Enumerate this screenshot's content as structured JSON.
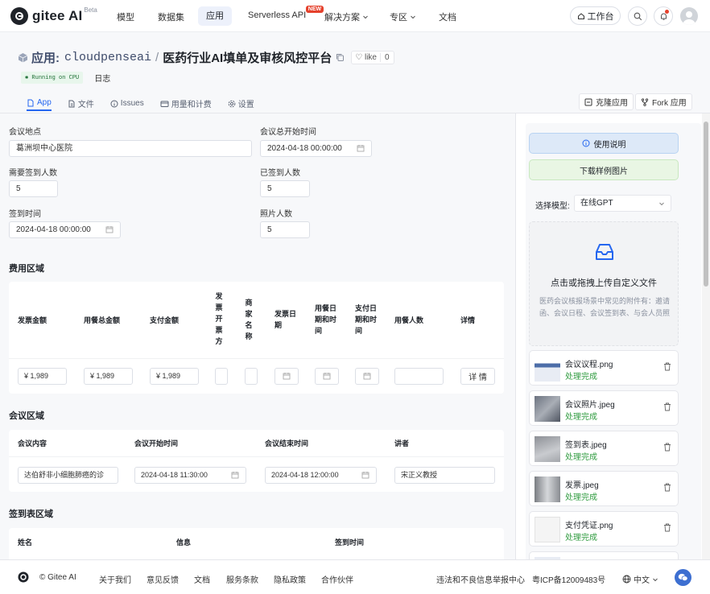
{
  "nav": {
    "logo_text": "gitee AI",
    "beta": "Beta",
    "items": [
      "模型",
      "数据集",
      "应用",
      "Serverless API",
      "解决方案",
      "专区",
      "文档"
    ],
    "new_badge": "NEW",
    "workbench": "工作台"
  },
  "header": {
    "app_label": "应用:",
    "owner": "cloudpenseai",
    "separator": "/",
    "app_name": "医药行业AI填单及审核风控平台",
    "like_label": "like",
    "like_count": "0",
    "status": "Running on CPU",
    "log": "日志",
    "tabs": [
      "App",
      "文件",
      "Issues",
      "用量和计费",
      "设置"
    ],
    "clone": "克隆应用",
    "fork": "Fork 应用"
  },
  "form": {
    "location_label": "会议地点",
    "location_value": "葛洲坝中心医院",
    "start_label": "会议总开始时间",
    "start_value": "2024-04-18 00:00:00",
    "signin_need_label": "需要签到人数",
    "signin_need_value": "5",
    "signed_label": "已签到人数",
    "signed_value": "5",
    "signin_time_label": "签到时间",
    "signin_time_value": "2024-04-18 00:00:00",
    "photo_label": "照片人数",
    "photo_value": "5"
  },
  "expense": {
    "title": "费用区域",
    "headers": [
      "发票金额",
      "用餐总金额",
      "支付金额",
      "发票开票方",
      "商家名称",
      "发票日期",
      "用餐日期和时间",
      "支付日期和时间",
      "用餐人数",
      "详情"
    ],
    "row": {
      "invoice": "¥ 1,989",
      "meal_total": "¥ 1,989",
      "payment": "¥ 1,989",
      "detail": "详 情"
    }
  },
  "meeting": {
    "title": "会议区域",
    "headers": [
      "会议内容",
      "会议开始时间",
      "会议结束时间",
      "讲者"
    ],
    "row": {
      "content": "达伯舒非小细胞肺癌的诊",
      "start": "2024-04-18 11:30:00",
      "end": "2024-04-18 12:00:00",
      "speaker": "宋正义教授"
    }
  },
  "signin_table": {
    "title": "签到表区域",
    "headers": [
      "姓名",
      "信息",
      "签到时间"
    ]
  },
  "sidebar": {
    "guide": "使用说明",
    "download": "下载样例图片",
    "model_label": "选择模型:",
    "model_value": "在线GPT",
    "upload_title": "点击或拖拽上传自定义文件",
    "upload_desc": "医药会议核报场景中常见的附件有：邀请函、会议日程、会议签到表、与会人员照片、演示PPT、发票、餐饮水单……",
    "files": [
      {
        "name": "会议议程.png",
        "status": "处理完成"
      },
      {
        "name": "会议照片.jpeg",
        "status": "处理完成"
      },
      {
        "name": "签到表.jpeg",
        "status": "处理完成"
      },
      {
        "name": "发票.jpeg",
        "status": "处理完成"
      },
      {
        "name": "支付凭证.png",
        "status": "处理完成"
      }
    ]
  },
  "footer": {
    "copyright": "© Gitee AI",
    "links": [
      "关于我们",
      "意见反馈",
      "文档",
      "服务条款",
      "隐私政策",
      "合作伙伴"
    ],
    "report": "违法和不良信息举报中心",
    "icp": "粤ICP备12009483号",
    "lang": "中文"
  },
  "colors": {
    "accent": "#2466f0",
    "success": "#2f9b3f",
    "notification": "#e5412c"
  }
}
